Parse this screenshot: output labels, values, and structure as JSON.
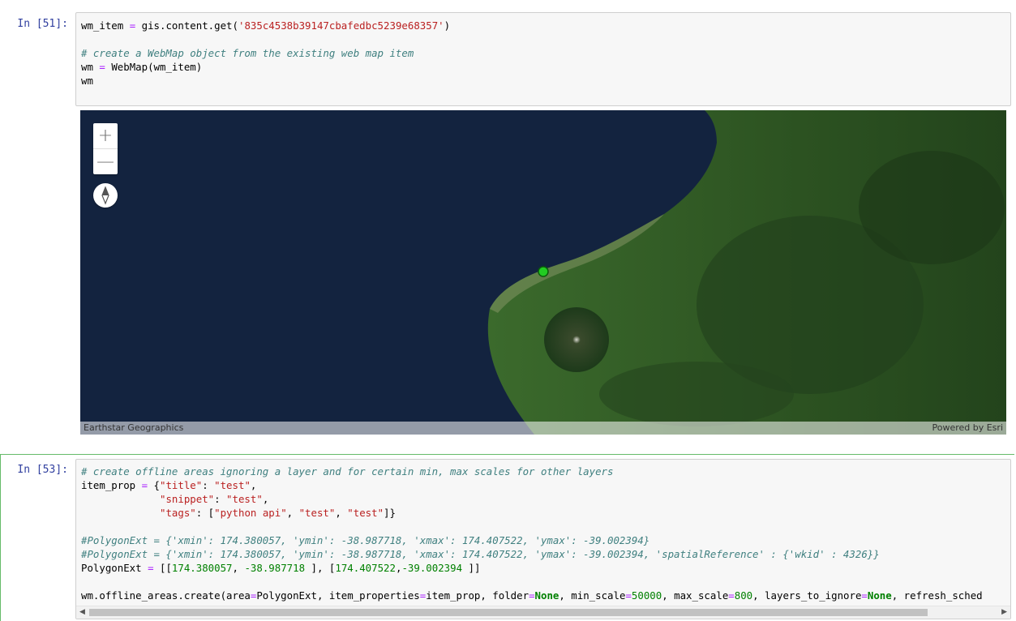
{
  "cell1": {
    "prompt": "In [51]:",
    "lines": [
      [
        {
          "t": "wm_item "
        },
        {
          "t": "=",
          "c": "op"
        },
        {
          "t": " gis.content.get("
        },
        {
          "t": "'835c4538b39147cbafedbc5239e68357'",
          "c": "st"
        },
        {
          "t": ")"
        }
      ],
      [],
      [
        {
          "t": "# create a WebMap object from the existing web map item",
          "c": "cm"
        }
      ],
      [
        {
          "t": "wm "
        },
        {
          "t": "=",
          "c": "op"
        },
        {
          "t": " WebMap(wm_item)"
        }
      ],
      [
        {
          "t": "wm"
        }
      ]
    ]
  },
  "map": {
    "zoom_in": "+",
    "zoom_out": "—",
    "attribution_left": "Earthstar Geographics",
    "attribution_right": "Powered by Esri",
    "colors": {
      "ocean": "#13233f",
      "land": "#2e5a26",
      "marker": "#22cc22"
    }
  },
  "cell2": {
    "prompt": "In [53]:",
    "lines": [
      [
        {
          "t": "# create offline areas ignoring a layer and for certain min, max scales for other layers",
          "c": "cm"
        }
      ],
      [
        {
          "t": "item_prop "
        },
        {
          "t": "=",
          "c": "op"
        },
        {
          "t": " {"
        },
        {
          "t": "\"title\"",
          "c": "st"
        },
        {
          "t": ": "
        },
        {
          "t": "\"test\"",
          "c": "st"
        },
        {
          "t": ","
        }
      ],
      [
        {
          "t": "             "
        },
        {
          "t": "\"snippet\"",
          "c": "st"
        },
        {
          "t": ": "
        },
        {
          "t": "\"test\"",
          "c": "st"
        },
        {
          "t": ","
        }
      ],
      [
        {
          "t": "             "
        },
        {
          "t": "\"tags\"",
          "c": "st"
        },
        {
          "t": ": ["
        },
        {
          "t": "\"python api\"",
          "c": "st"
        },
        {
          "t": ", "
        },
        {
          "t": "\"test\"",
          "c": "st"
        },
        {
          "t": ", "
        },
        {
          "t": "\"test\"",
          "c": "st"
        },
        {
          "t": "]}"
        }
      ],
      [],
      [
        {
          "t": "#PolygonExt = {'xmin': 174.380057, 'ymin': -38.987718, 'xmax': 174.407522, 'ymax': -39.002394}",
          "c": "cm"
        }
      ],
      [
        {
          "t": "#PolygonExt = {'xmin': 174.380057, 'ymin': -38.987718, 'xmax': 174.407522, 'ymax': -39.002394, 'spatialReference' : {'wkid' : 4326}}",
          "c": "cm"
        }
      ],
      [
        {
          "t": "PolygonExt "
        },
        {
          "t": "=",
          "c": "op"
        },
        {
          "t": " [["
        },
        {
          "t": "174.380057",
          "c": "nm"
        },
        {
          "t": ", "
        },
        {
          "t": "-38.987718",
          "c": "nm"
        },
        {
          "t": " ], ["
        },
        {
          "t": "174.407522",
          "c": "nm"
        },
        {
          "t": ","
        },
        {
          "t": "-39.002394",
          "c": "nm"
        },
        {
          "t": " ]]"
        }
      ],
      [],
      [
        {
          "t": "wm.offline_areas.create(area"
        },
        {
          "t": "=",
          "c": "op"
        },
        {
          "t": "PolygonExt, item_properties"
        },
        {
          "t": "=",
          "c": "op"
        },
        {
          "t": "item_prop, folder"
        },
        {
          "t": "=",
          "c": "op"
        },
        {
          "t": "None",
          "c": "kw"
        },
        {
          "t": ", min_scale"
        },
        {
          "t": "=",
          "c": "op"
        },
        {
          "t": "50000",
          "c": "nm"
        },
        {
          "t": ", max_scale"
        },
        {
          "t": "=",
          "c": "op"
        },
        {
          "t": "800",
          "c": "nm"
        },
        {
          "t": ", layers_to_ignore"
        },
        {
          "t": "=",
          "c": "op"
        },
        {
          "t": "None",
          "c": "kw"
        },
        {
          "t": ", refresh_sched"
        }
      ]
    ]
  }
}
